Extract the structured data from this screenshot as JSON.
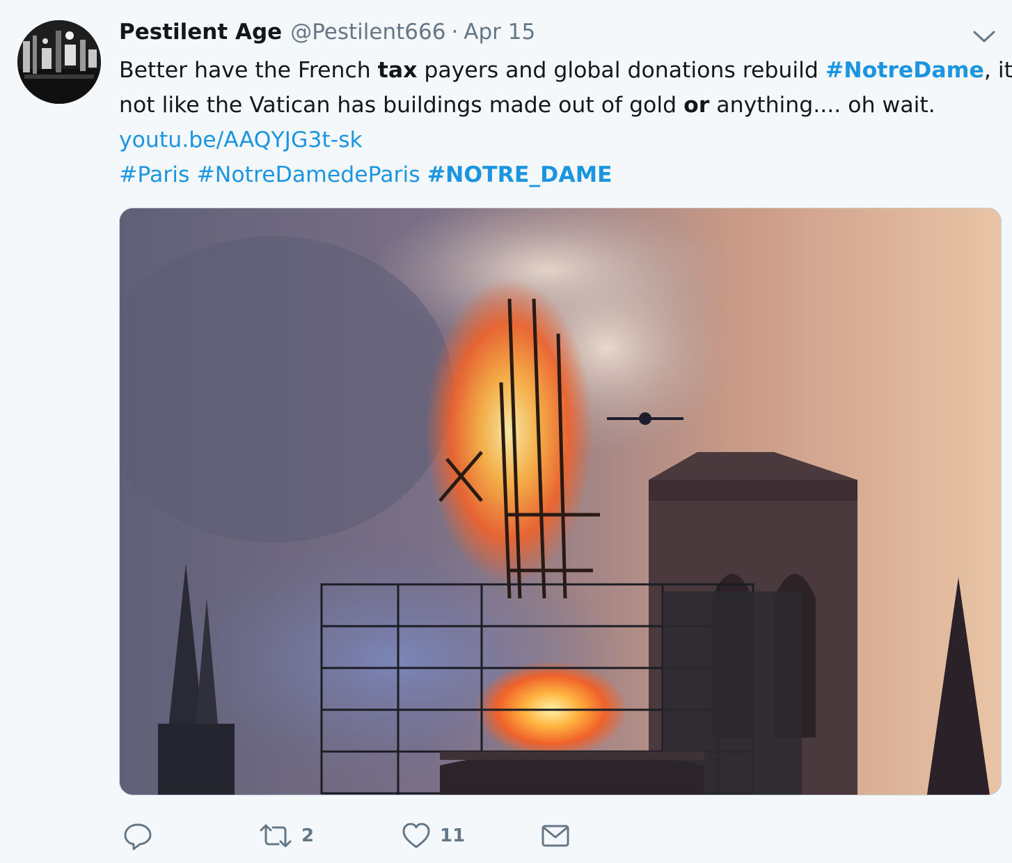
{
  "tweet": {
    "author_name": "Pestilent Age",
    "handle": "@Pestilent666",
    "separator": "·",
    "date": "Apr 15",
    "text": {
      "line1": {
        "part1": "Better have the French ",
        "bold1": "tax",
        "part2": " payers and global donations rebuild ",
        "hashtag": "#NotreDame",
        "part3": ", it's"
      },
      "line2": {
        "part1": "not like the Vatican has buildings made out of gold ",
        "bold1": "or",
        "part2": " anything.... oh wait."
      },
      "link": "youtu.be/AAQYJG3t-sk",
      "hashtags": [
        "#Paris",
        "#NotreDamedeParis",
        "#NOTRE_DAME"
      ]
    },
    "actions": {
      "reply_count": "",
      "retweet_count": "2",
      "like_count": "11"
    }
  },
  "colors": {
    "link": "#1b95e0",
    "secondary_text": "#657786",
    "background": "#f5f8fa"
  },
  "icons": [
    "caret-down-icon",
    "reply-icon",
    "retweet-icon",
    "heart-icon",
    "envelope-icon"
  ]
}
